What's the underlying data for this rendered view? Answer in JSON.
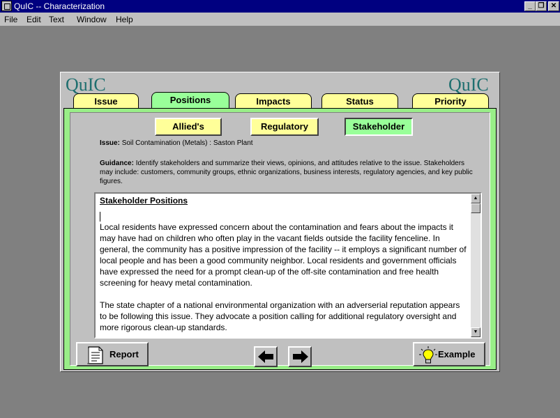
{
  "window": {
    "title": "QuIC -- Characterization"
  },
  "menu": [
    {
      "label": "File",
      "key": "F"
    },
    {
      "label": "Edit",
      "key": "E"
    },
    {
      "label": "Text",
      "key": "T"
    },
    {
      "label": "Window",
      "key": "W"
    },
    {
      "label": "Help",
      "key": "H"
    }
  ],
  "logo": {
    "left": "QuIC",
    "right": "QuIC"
  },
  "tabs": [
    {
      "label": "Issue",
      "active": false
    },
    {
      "label": "Positions",
      "active": true
    },
    {
      "label": "Impacts",
      "active": false
    },
    {
      "label": "Status",
      "active": false
    },
    {
      "label": "Priority",
      "active": false
    }
  ],
  "subtabs": [
    {
      "label": "Allied's",
      "active": false
    },
    {
      "label": "Regulatory",
      "active": false
    },
    {
      "label": "Stakeholder",
      "active": true
    }
  ],
  "issue": {
    "label": "Issue:",
    "text": "Soil Contamination (Metals) : Saston Plant"
  },
  "guidance": {
    "label": "Guidance:",
    "text": "Identify stakeholders and summarize their views, opinions, and attitudes relative to the issue. Stakeholders may include:  customers, community groups, ethnic organizations, business interests, regulatory agencies, and key public figures."
  },
  "editor": {
    "heading": "Stakeholder Positions",
    "paragraphs": [
      "Local residents have expressed concern about the contamination and fears about the impacts it may have had on children who often play in the vacant fields outside the facility fenceline.  In general, the community has a positive impression of the facility -- it employs a significant number of local people and has been a good community neighbor.  Local residents and government officials have expressed the need for a prompt clean-up of the off-site contamination and free health screening for heavy metal contamination.",
      "The state chapter of a national environmental organization with an adverserial reputation appears to be following this issue.  They advocate a position calling for additional regulatory oversight and more rigorous clean-up standards."
    ]
  },
  "buttons": {
    "report": "Report",
    "example": "Example"
  },
  "colors": {
    "tab_yellow": "#ffff99",
    "tab_green": "#99ff99",
    "frame_green": "#99ee88",
    "logo_teal": "#1f6f6f"
  }
}
